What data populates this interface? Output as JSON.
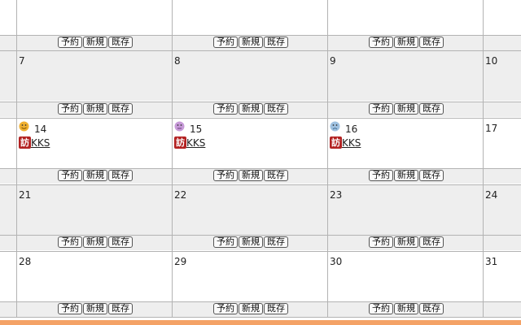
{
  "button_labels": {
    "reserve": "予約",
    "new": "新規",
    "existing": "既存"
  },
  "colors": {
    "weekday_bg": "#ffffff",
    "shaded_bg": "#eeeeee",
    "accent_bar": "#f4a266",
    "visit_icon": "#b32222"
  },
  "visit_icon_glyph": "訪",
  "weeks": [
    {
      "shaded": false,
      "days": [
        "",
        "",
        "",
        ""
      ]
    },
    {
      "shaded": true,
      "days": [
        "7",
        "8",
        "9",
        "10"
      ]
    },
    {
      "shaded": false,
      "days": [
        "14",
        "15",
        "16",
        "17"
      ],
      "moods": [
        "happy-face-icon",
        "neutral-face-icon",
        "sad-face-icon",
        ""
      ],
      "mood_colors": [
        "#f0b030",
        "#c79ad8",
        "#9fc1e0",
        ""
      ],
      "events": [
        "KKS",
        "KKS",
        "KKS",
        ""
      ]
    },
    {
      "shaded": true,
      "days": [
        "21",
        "22",
        "23",
        "24"
      ]
    },
    {
      "shaded": false,
      "days": [
        "28",
        "29",
        "30",
        "31"
      ]
    }
  ]
}
